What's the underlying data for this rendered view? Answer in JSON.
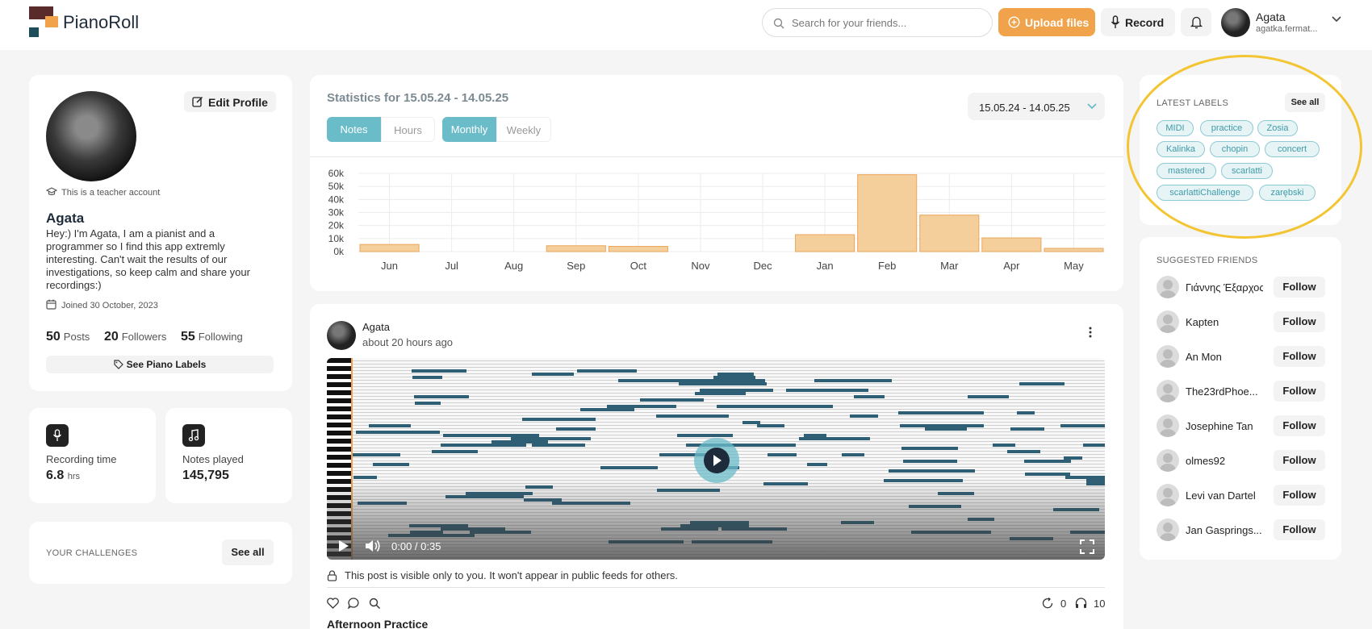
{
  "header": {
    "logo_text": "PianoRoll",
    "search_placeholder": "Search for your friends...",
    "upload_label": "Upload files",
    "record_label": "Record",
    "user_name": "Agata",
    "user_email": "agatka.fermat..."
  },
  "profile": {
    "edit_label": "Edit Profile",
    "teacher_note": "This is a teacher account",
    "name": "Agata",
    "bio": "Hey:) I'm Agata, I am a pianist and a programmer so I find this app extremly interesting. Can't wait the results of our investigations, so keep calm and share your recordings:)",
    "joined": "Joined 30 October, 2023",
    "posts_count": "50",
    "posts_label": "Posts",
    "followers_count": "20",
    "followers_label": "Followers",
    "following_count": "55",
    "following_label": "Following",
    "labels_button": "See Piano Labels"
  },
  "metrics": {
    "recording_label": "Recording time",
    "recording_value": "6.8",
    "recording_unit": "hrs",
    "notes_label": "Notes played",
    "notes_value": "145,795"
  },
  "challenges": {
    "title": "YOUR CHALLENGES",
    "see_all": "See all"
  },
  "statistics": {
    "title": "Statistics for 15.05.24 - 14.05.25",
    "toggle_notes": "Notes",
    "toggle_hours": "Hours",
    "toggle_monthly": "Monthly",
    "toggle_weekly": "Weekly",
    "date_range": "15.05.24 - 14.05.25"
  },
  "chart_data": {
    "type": "bar",
    "categories": [
      "Jun",
      "Jul",
      "Aug",
      "Sep",
      "Oct",
      "Nov",
      "Dec",
      "Jan",
      "Feb",
      "Mar",
      "Apr",
      "May"
    ],
    "values": [
      5500,
      0,
      0,
      4500,
      4000,
      0,
      0,
      13000,
      59000,
      28000,
      10500,
      2500
    ],
    "yticks": [
      "0k",
      "10k",
      "20k",
      "30k",
      "40k",
      "50k",
      "60k"
    ],
    "ylim": [
      0,
      60000
    ],
    "grid": true,
    "bar_color": "#f5cf9b",
    "bar_border": "#eaa65a"
  },
  "post": {
    "author": "Agata",
    "time_ago": "about 20 hours ago",
    "player_time": "0:00 / 0:35",
    "privacy_note": "This post is visible only to you. It won't appear in public feeds for others.",
    "reposts": "0",
    "listens": "10",
    "title": "Afternoon Practice"
  },
  "labels": {
    "title": "LATEST LABELS",
    "see_all": "See all",
    "items": [
      "MIDI",
      "practice",
      "Zosia",
      "Kalinka",
      "chopin",
      "concert",
      "mastered",
      "scarlatti",
      "scarlattiChallenge",
      "zarębski"
    ]
  },
  "friends": {
    "title": "SUGGESTED FRIENDS",
    "follow_label": "Follow",
    "items": [
      "Γιάννης Έξαρχος",
      "Kapten",
      "An Mon",
      "The23rdPhoe...",
      "Josephine Tan",
      "olmes92",
      "Levi van Dartel",
      "Jan Gasprings..."
    ]
  },
  "colors": {
    "accent_teal": "#6bbcc9",
    "accent_orange": "#f0a34a",
    "note_color": "#2f5f75",
    "highlight": "#f3c532"
  }
}
